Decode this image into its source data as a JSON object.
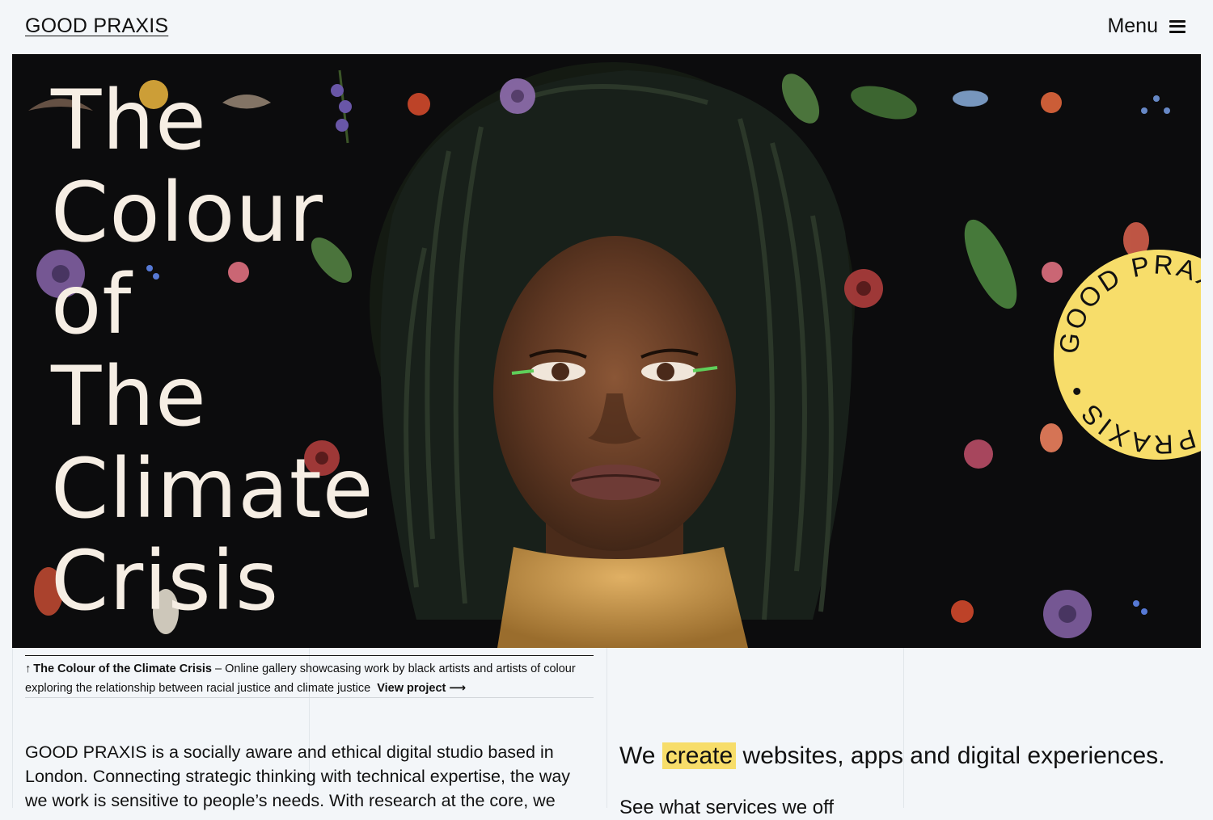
{
  "header": {
    "logo": "GOOD PRAXIS",
    "menu_label": "Menu"
  },
  "hero": {
    "title_lines": [
      "The",
      "Colour",
      "of",
      "The",
      "Climate",
      "Crisis"
    ],
    "badge_text": "GOOD PRAXIS • GOOD PRAXIS • "
  },
  "caption": {
    "arrow": "↑",
    "project_name": "The Colour of the Climate Crisis",
    "description": " – Online gallery showcasing work by black artists and artists of colour exploring the relationship between racial justice and climate justice",
    "link_label": "View project ⟶"
  },
  "intro": {
    "text": "GOOD PRAXIS is a socially aware and ethical digital studio based in London. Connecting strategic thinking with technical expertise, the way we work is sensitive to people’s needs. With research at the core, we"
  },
  "tagline": {
    "before": "We ",
    "highlight": "create",
    "after": " websites, apps and digital experiences."
  },
  "subtext": "See what services we off",
  "colors": {
    "background": "#f3f6f9",
    "hero_background": "#0c0c0d",
    "accent_yellow": "#f7dd6a",
    "title_cream": "#f6eee4"
  },
  "icons": {
    "menu": "hamburger-icon",
    "caption_arrow": "arrow-up-icon"
  }
}
